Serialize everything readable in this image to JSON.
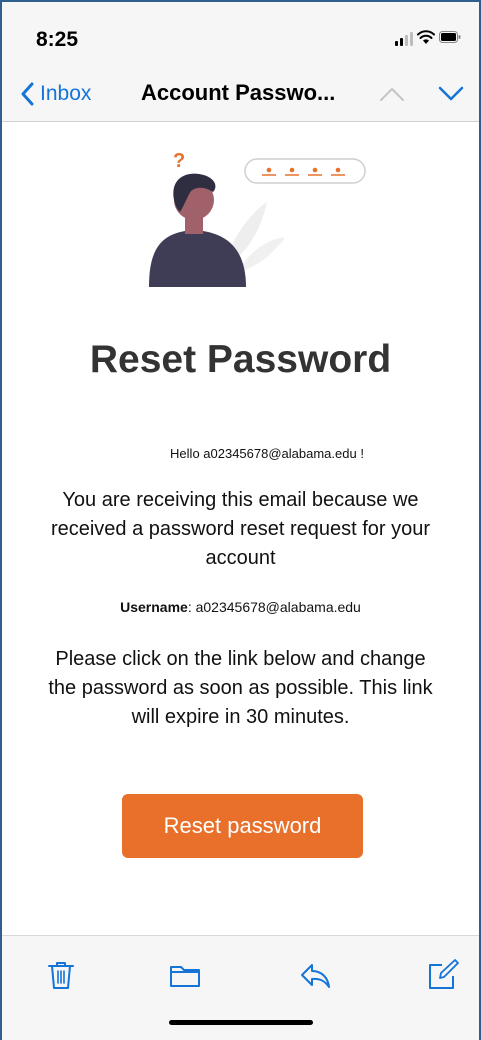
{
  "status_bar": {
    "time": "8:25"
  },
  "nav": {
    "back_label": "Inbox",
    "title": "Account Passwo..."
  },
  "email": {
    "heading": "Reset Password",
    "greeting": "Hello  a02345678@alabama.edu !",
    "paragraph_1": "You are receiving this email because we received a password reset request for your account",
    "username_key": "Username",
    "username_sep": ": ",
    "username_value": "a02345678@alabama.edu",
    "paragraph_2": "Please click on the link below and change the password as soon as possible. This link will expire in 30 minutes.",
    "button_label": "Reset password"
  },
  "colors": {
    "accent_blue": "#1474d8",
    "button_orange": "#e8702a",
    "heading_gray": "#333333",
    "illustration_dark": "#3f3d56",
    "illustration_skin": "#a0616a",
    "illustration_hair": "#2f2e41"
  },
  "icons": {
    "back": "chevron-left-icon",
    "prev": "chevron-up-icon",
    "next": "chevron-down-icon",
    "trash": "trash-icon",
    "folder": "folder-icon",
    "reply": "reply-icon",
    "compose": "compose-icon"
  }
}
